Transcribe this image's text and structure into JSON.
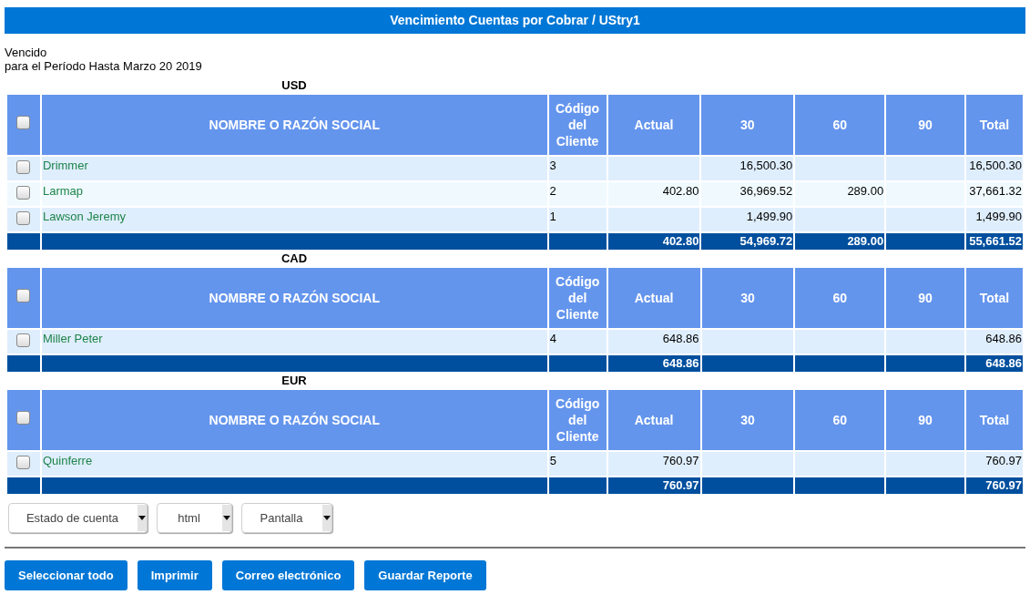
{
  "title": "Vencimiento Cuentas por Cobrar / UStry1",
  "subtitle": [
    "Vencido",
    "para el Período Hasta Marzo 20 2019"
  ],
  "sections": [
    {
      "currency": "USD",
      "header_checked": false,
      "columns": [
        "NOMBRE O RAZÓN SOCIAL",
        "Código del Cliente",
        "Actual",
        "30",
        "60",
        "90",
        "Total"
      ],
      "rows": [
        {
          "checked": false,
          "name": "Drimmer",
          "code": "3",
          "d30": "16,500.30",
          "total": "16,500.30"
        },
        {
          "checked": false,
          "name": "Larmap",
          "code": "2",
          "actual": "402.80",
          "d30": "36,969.52",
          "d60": "289.00",
          "total": "37,661.32"
        },
        {
          "checked": false,
          "name": "Lawson Jeremy",
          "code": "1",
          "d30": "1,499.90",
          "total": "1,499.90"
        }
      ],
      "totals": {
        "actual": "402.80",
        "d30": "54,969.72",
        "d60": "289.00",
        "total": "55,661.52"
      }
    },
    {
      "currency": "CAD",
      "header_checked": false,
      "columns": [
        "NOMBRE O RAZÓN SOCIAL",
        "Código del Cliente",
        "Actual",
        "30",
        "60",
        "90",
        "Total"
      ],
      "rows": [
        {
          "checked": false,
          "name": "Miller Peter",
          "code": "4",
          "actual": "648.86",
          "total": "648.86"
        }
      ],
      "totals": {
        "actual": "648.86",
        "total": "648.86"
      }
    },
    {
      "currency": "EUR",
      "header_checked": false,
      "columns": [
        "NOMBRE O RAZÓN SOCIAL",
        "Código del Cliente",
        "Actual",
        "30",
        "60",
        "90",
        "Total"
      ],
      "rows": [
        {
          "checked": false,
          "name": "Quinferre",
          "code": "5",
          "actual": "760.97",
          "total": "760.97"
        }
      ],
      "totals": {
        "actual": "760.97",
        "total": "760.97"
      }
    }
  ],
  "selects": [
    {
      "value": "Estado de cuenta"
    },
    {
      "value": "html"
    },
    {
      "value": "Pantalla"
    }
  ],
  "buttons": [
    "Seleccionar todo",
    "Imprimir",
    "Correo electrónico",
    "Guardar Reporte"
  ]
}
